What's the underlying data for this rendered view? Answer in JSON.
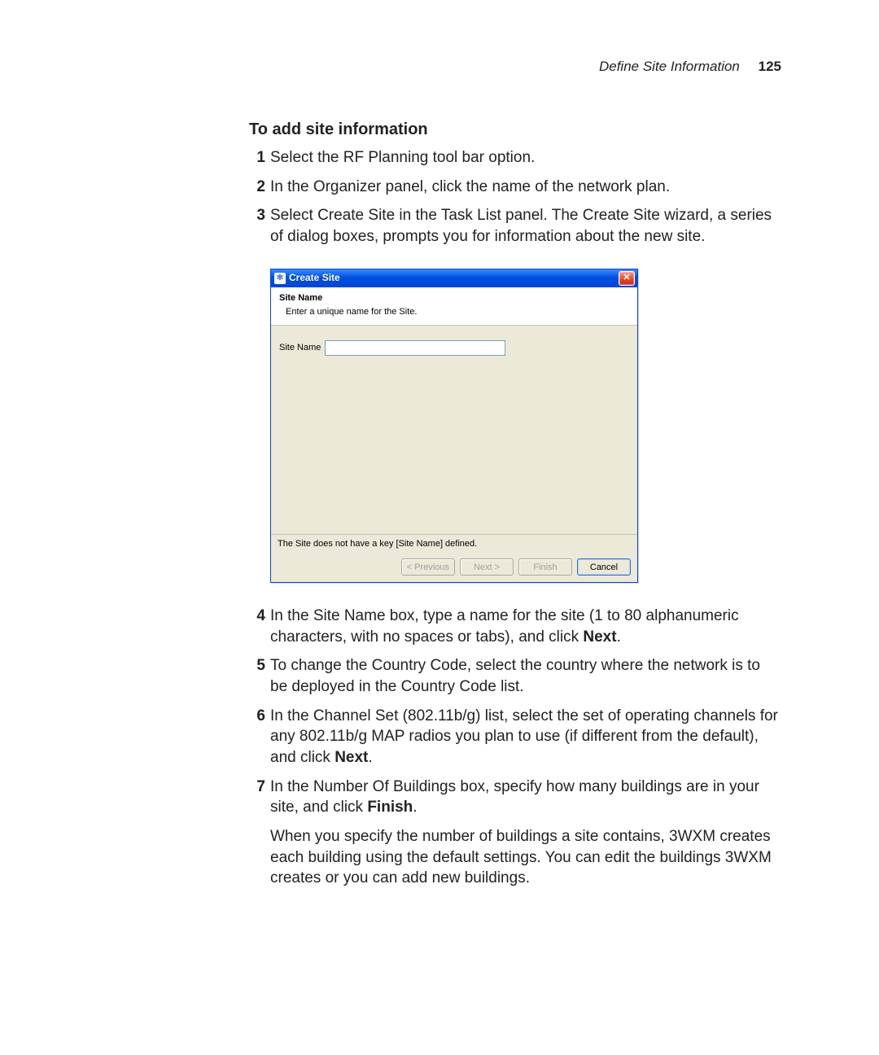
{
  "header": {
    "section": "Define Site Information",
    "page_number": "125"
  },
  "proc": {
    "title": "To add site information"
  },
  "steps": {
    "s1": "Select the RF Planning tool bar option.",
    "s2": "In the Organizer panel, click the name of the network plan.",
    "s3": "Select Create Site in the Task List panel. The Create Site wizard, a series of dialog boxes, prompts you for information about the new site.",
    "s4a": "In the Site Name box, type a name for the site (1 to 80 alphanumeric characters, with no spaces or tabs), and click ",
    "s4b": "Next",
    "s4c": ".",
    "s5": "To change the Country Code, select the country where the network is to be deployed in the Country Code list.",
    "s6a": "In the Channel Set (802.11b/g) list, select the set of operating channels for any 802.11b/g MAP radios you plan to use (if different from the default), and click ",
    "s6b": "Next",
    "s6c": ".",
    "s7a": "In the Number Of Buildings box, specify how many buildings are in your site, and click ",
    "s7b": "Finish",
    "s7c": ".",
    "s7p": "When you specify the number of buildings a site contains, 3WXM creates each building using the default settings. You can edit the buildings 3WXM creates or you can add new buildings."
  },
  "dialog": {
    "title": "Create Site",
    "header_title": "Site Name",
    "header_sub": "Enter a unique name for the Site.",
    "field_label": "Site Name",
    "field_value": "",
    "status": "The Site does not have a key [Site Name] defined.",
    "buttons": {
      "previous": "< Previous",
      "next": "Next >",
      "finish": "Finish",
      "cancel": "Cancel"
    }
  }
}
